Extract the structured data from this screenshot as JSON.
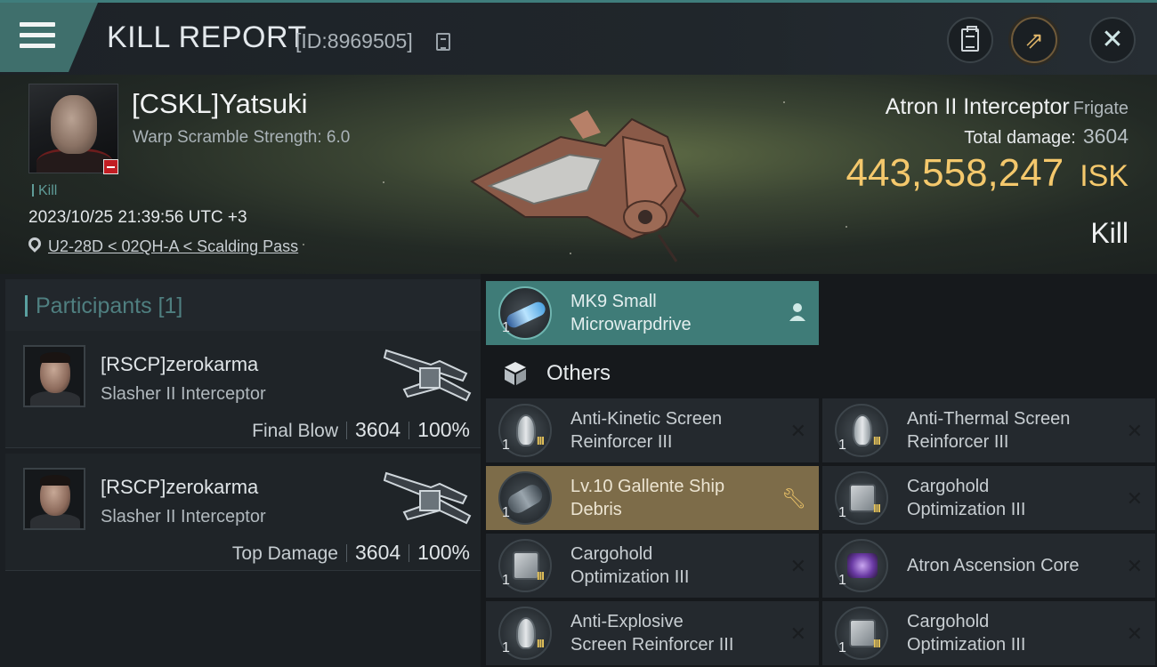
{
  "header": {
    "title": "KILL REPORT",
    "report_id": "[ID:8969505]"
  },
  "victim": {
    "name": "[CSKL]Yatsuki",
    "warp_scramble": "Warp Scramble Strength: 6.0",
    "tag": "Kill",
    "datetime": "2023/10/25 21:39:56 UTC +3",
    "location": "U2-28D < 02QH-A < Scalding Pass",
    "ship_name": "Atron II Interceptor",
    "ship_class": "Frigate",
    "total_damage_label": "Total damage:",
    "total_damage": "3604",
    "isk_value": "443,558,247",
    "isk_unit": "ISK",
    "result": "Kill"
  },
  "participants": {
    "label": "Participants [1]",
    "rows": [
      {
        "name": "[RSCP]zerokarma",
        "ship": "Slasher II Interceptor",
        "role": "Final Blow",
        "damage": "3604",
        "percent": "100%"
      },
      {
        "name": "[RSCP]zerokarma",
        "ship": "Slasher II Interceptor",
        "role": "Top Damage",
        "damage": "3604",
        "percent": "100%"
      }
    ]
  },
  "modules": {
    "top": {
      "qty": "1",
      "name_line1": "MK9 Small",
      "name_line2": "Microwarpdrive"
    },
    "others_label": "Others",
    "items": [
      {
        "qty": "1",
        "level": "III",
        "line1": "Anti-Kinetic Screen",
        "line2": "Reinforcer III"
      },
      {
        "qty": "1",
        "level": "III",
        "line1": "Anti-Thermal Screen",
        "line2": "Reinforcer III"
      },
      {
        "qty": "1",
        "level": "",
        "line1": "Lv.10 Gallente Ship",
        "line2": "Debris"
      },
      {
        "qty": "1",
        "level": "III",
        "line1": "Cargohold",
        "line2": "Optimization III"
      },
      {
        "qty": "1",
        "level": "III",
        "line1": "Cargohold",
        "line2": "Optimization III"
      },
      {
        "qty": "1",
        "level": "",
        "line1": "Atron Ascension Core",
        "line2": ""
      },
      {
        "qty": "1",
        "level": "III",
        "line1": "Anti-Explosive",
        "line2": "Screen Reinforcer III"
      },
      {
        "qty": "1",
        "level": "III",
        "line1": "Cargohold",
        "line2": "Optimization III"
      }
    ]
  },
  "colors": {
    "accent_teal": "#3f7c78",
    "isk_gold": "#f4c86c",
    "fitted_gold": "#7d6c49",
    "level_yellow": "#e7c45a"
  },
  "icons": {
    "menu": "hamburger-icon",
    "copy": "copy-icon",
    "clipboard": "clipboard-icon",
    "share": "share-icon",
    "close": "close-icon",
    "location": "map-pin-icon",
    "others": "cube-icon",
    "pilot": "person-icon",
    "fitted": "wrench-icon",
    "destroyed": "x-mark-icon"
  }
}
